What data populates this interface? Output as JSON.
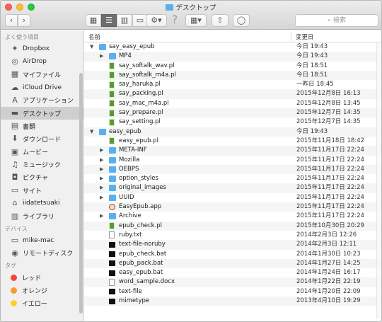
{
  "window": {
    "title": "デスクトップ",
    "search_placeholder": "検索"
  },
  "toolbar": {
    "back": "‹",
    "forward": "›",
    "help": "?",
    "share": "⇧",
    "tag": "◯"
  },
  "sidebar": {
    "favorites_header": "よく使う項目",
    "favorites": [
      {
        "label": "Dropbox",
        "icon": "dropbox-icon",
        "glyph": "✦"
      },
      {
        "label": "AirDrop",
        "icon": "airdrop-icon",
        "glyph": "◎"
      },
      {
        "label": "マイファイル",
        "icon": "all-files-icon",
        "glyph": "▦"
      },
      {
        "label": "iCloud Drive",
        "icon": "cloud-icon",
        "glyph": "☁"
      },
      {
        "label": "アプリケーション",
        "icon": "applications-icon",
        "glyph": "A"
      },
      {
        "label": "デスクトップ",
        "icon": "desktop-icon",
        "glyph": "▬"
      },
      {
        "label": "書類",
        "icon": "documents-icon",
        "glyph": "▤"
      },
      {
        "label": "ダウンロード",
        "icon": "downloads-icon",
        "glyph": "⬇"
      },
      {
        "label": "ムービー",
        "icon": "movies-icon",
        "glyph": "▣"
      },
      {
        "label": "ミュージック",
        "icon": "music-icon",
        "glyph": "♫"
      },
      {
        "label": "ピクチャ",
        "icon": "pictures-icon",
        "glyph": "◘"
      },
      {
        "label": "サイト",
        "icon": "sites-icon",
        "glyph": "▭"
      },
      {
        "label": "iidatetsuaki",
        "icon": "home-icon",
        "glyph": "⌂"
      },
      {
        "label": "ライブラリ",
        "icon": "library-icon",
        "glyph": "▥"
      }
    ],
    "devices_header": "デバイス",
    "devices": [
      {
        "label": "mike-mac",
        "icon": "computer-icon",
        "glyph": "▭"
      },
      {
        "label": "リモートディスク",
        "icon": "remote-disc-icon",
        "glyph": "◉"
      }
    ],
    "tags_header": "タグ",
    "tags": [
      {
        "label": "レッド",
        "color": "#f1453d"
      },
      {
        "label": "オレンジ",
        "color": "#fa9a2c"
      },
      {
        "label": "イエロー",
        "color": "#fcd02c"
      }
    ]
  },
  "columns": {
    "name": "名前",
    "date": "変更日"
  },
  "files": [
    {
      "name": "say_easy_epub",
      "date": "今日 19:43",
      "type": "folder",
      "depth": 0,
      "expanded": true
    },
    {
      "name": "MP4",
      "date": "今日 19:43",
      "type": "folder",
      "depth": 1,
      "expanded": false
    },
    {
      "name": "say_softalk_wav.pl",
      "date": "今日 18:51",
      "type": "script",
      "depth": 1
    },
    {
      "name": "say_softalk_m4a.pl",
      "date": "今日 18:51",
      "type": "script",
      "depth": 1
    },
    {
      "name": "say_haruka.pl",
      "date": "一昨日 18:45",
      "type": "script",
      "depth": 1
    },
    {
      "name": "say_packing.pl",
      "date": "2015年12月8日 16:13",
      "type": "script",
      "depth": 1
    },
    {
      "name": "say_mac_m4a.pl",
      "date": "2015年12月8日 13:45",
      "type": "script",
      "depth": 1
    },
    {
      "name": "say_prepare.pl",
      "date": "2015年12月7日 14:35",
      "type": "script",
      "depth": 1
    },
    {
      "name": "say_setting.pl",
      "date": "2015年12月7日 14:35",
      "type": "script",
      "depth": 1
    },
    {
      "name": "easy_epub",
      "date": "今日 19:43",
      "type": "folder",
      "depth": 0,
      "expanded": true
    },
    {
      "name": "easy_epub.pl",
      "date": "2015年11月18日 18:42",
      "type": "script",
      "depth": 1
    },
    {
      "name": "META-INF",
      "date": "2015年11月17日 22:24",
      "type": "folder",
      "depth": 1,
      "expanded": false
    },
    {
      "name": "Mozilla",
      "date": "2015年11月17日 22:24",
      "type": "folder",
      "depth": 1,
      "expanded": false
    },
    {
      "name": "OEBPS",
      "date": "2015年11月17日 22:24",
      "type": "folder",
      "depth": 1,
      "expanded": false
    },
    {
      "name": "option_styles",
      "date": "2015年11月17日 22:24",
      "type": "folder",
      "depth": 1,
      "expanded": false
    },
    {
      "name": "original_images",
      "date": "2015年11月17日 22:24",
      "type": "folder",
      "depth": 1,
      "expanded": false
    },
    {
      "name": "UUID",
      "date": "2015年11月17日 22:24",
      "type": "folder",
      "depth": 1,
      "expanded": false
    },
    {
      "name": "EasyEpub.app",
      "date": "2015年11月17日 22:24",
      "type": "app",
      "depth": 1
    },
    {
      "name": "Archive",
      "date": "2015年11月17日 22:24",
      "type": "folder",
      "depth": 1,
      "expanded": false
    },
    {
      "name": "epub_check.pl",
      "date": "2015年10月30日 20:29",
      "type": "script",
      "depth": 1
    },
    {
      "name": "ruby.txt",
      "date": "2014年2月3日 12:26",
      "type": "text",
      "depth": 1
    },
    {
      "name": "text-file-noruby",
      "date": "2014年2月3日 12:11",
      "type": "exec",
      "depth": 1
    },
    {
      "name": "epub_check.bat",
      "date": "2014年1月30日 10:23",
      "type": "exec",
      "depth": 1
    },
    {
      "name": "epub_pack.bat",
      "date": "2014年1月27日 14:25",
      "type": "exec",
      "depth": 1
    },
    {
      "name": "easy_epub.bat",
      "date": "2014年1月24日 16:17",
      "type": "exec",
      "depth": 1
    },
    {
      "name": "word_sample.docx",
      "date": "2014年1月22日 22:19",
      "type": "text",
      "depth": 1
    },
    {
      "name": "text-file",
      "date": "2014年1月20日 22:09",
      "type": "exec",
      "depth": 1
    },
    {
      "name": "mimetype",
      "date": "2013年4月10日 19:29",
      "type": "exec",
      "depth": 1
    }
  ]
}
